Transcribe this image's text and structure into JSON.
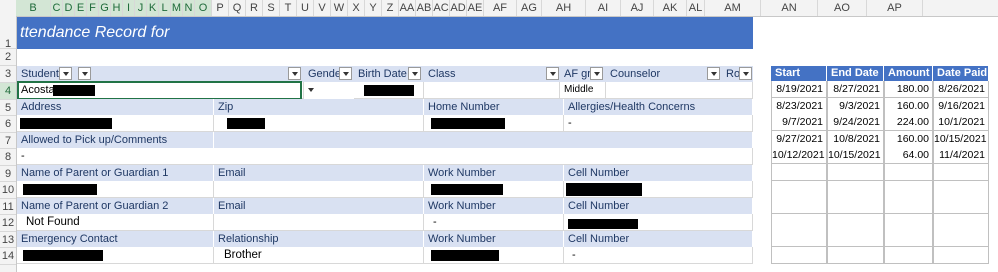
{
  "columns": [
    "B",
    "C",
    "D",
    "E",
    "F",
    "G",
    "H",
    "I",
    "J",
    "K",
    "L",
    "M",
    "N",
    "O",
    "P",
    "Q",
    "R",
    "S",
    "T",
    "U",
    "V",
    "W",
    "X",
    "Y",
    "Z",
    "AA",
    "AB",
    "AC",
    "AD",
    "AE",
    "AF",
    "AG",
    "AH",
    "AI",
    "AJ",
    "AK",
    "AL",
    "AM",
    "AN",
    "AO",
    "AP"
  ],
  "rows": [
    "1",
    "2",
    "3",
    "4",
    "5",
    "6",
    "7",
    "8",
    "9",
    "10",
    "11",
    "12",
    "13",
    "14"
  ],
  "title": "ttendance Record for",
  "header": {
    "student": "Student",
    "col2": "",
    "gender": "Gender",
    "birth_date": "Birth Date",
    "class": "Class",
    "af_group": "AF gro",
    "counselor": "Counselor",
    "room": "Roo"
  },
  "record": {
    "student_name": "Acosta",
    "class_level": "Middle"
  },
  "labels": {
    "address": "Address",
    "zip": "Zip",
    "home_number": "Home Number",
    "allergies": "Allergies/Health Concerns",
    "allowed_pickup": "Allowed to Pick up/Comments",
    "parent1": "Name of Parent or Guardian 1",
    "email1": "Email",
    "work1": "Work Number",
    "cell1": "Cell Number",
    "parent2": "Name of Parent or Guardian 2",
    "email2": "Email",
    "work2": "Work Number",
    "cell2": "Cell Number",
    "emergency": "Emergency Contact",
    "relationship": "Relationship",
    "work3": "Work Number",
    "cell3": "Cell Number"
  },
  "values": {
    "allergies": "-",
    "allowed_pickup": "-",
    "parent2_name": "Not Found",
    "work2": "-",
    "relationship": "Brother",
    "cell3": "-"
  },
  "payments": {
    "headers": [
      "Start Date",
      "End Date",
      "Amount",
      "Date Paid"
    ],
    "rows": [
      [
        "8/19/2021",
        "8/27/2021",
        "180.00",
        "8/26/2021"
      ],
      [
        "8/23/2021",
        "9/3/2021",
        "160.00",
        "9/16/2021"
      ],
      [
        "9/7/2021",
        "9/24/2021",
        "224.00",
        "10/1/2021"
      ],
      [
        "9/27/2021",
        "10/8/2021",
        "160.00",
        "10/15/2021"
      ],
      [
        "10/12/2021",
        "10/15/2021",
        "64.00",
        "11/4/2021"
      ],
      [
        "",
        "",
        "",
        ""
      ],
      [
        "",
        "",
        "",
        ""
      ],
      [
        "",
        "",
        "",
        ""
      ],
      [
        "",
        "",
        "",
        ""
      ],
      [
        "",
        "",
        "",
        ""
      ],
      [
        "",
        "",
        "",
        ""
      ]
    ]
  }
}
